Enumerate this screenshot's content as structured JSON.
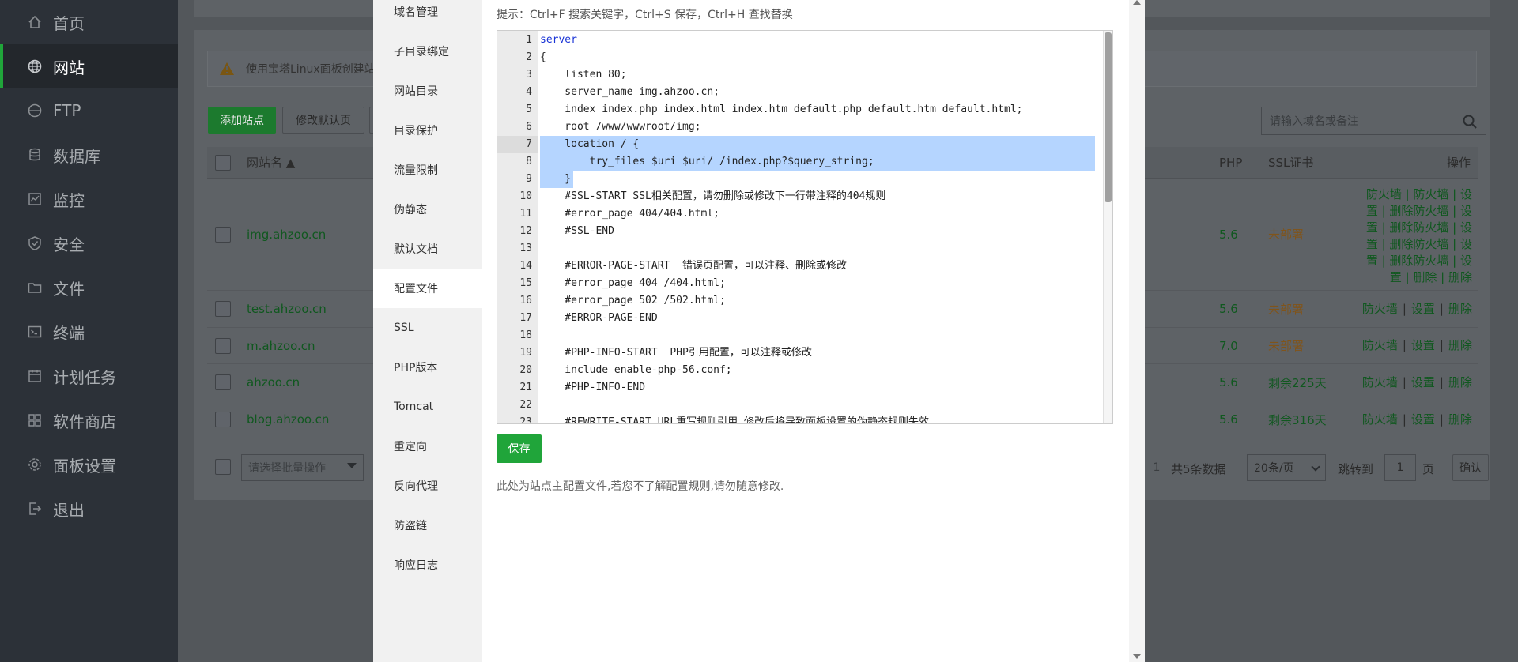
{
  "sidebar": {
    "items": [
      {
        "label": "首页",
        "icon": "home-icon"
      },
      {
        "label": "网站",
        "icon": "globe-icon"
      },
      {
        "label": "FTP",
        "icon": "ftp-icon"
      },
      {
        "label": "数据库",
        "icon": "database-icon"
      },
      {
        "label": "监控",
        "icon": "monitor-icon"
      },
      {
        "label": "安全",
        "icon": "shield-icon"
      },
      {
        "label": "文件",
        "icon": "folder-icon"
      },
      {
        "label": "终端",
        "icon": "terminal-icon"
      },
      {
        "label": "计划任务",
        "icon": "calendar-icon"
      },
      {
        "label": "软件商店",
        "icon": "apps-icon"
      },
      {
        "label": "面板设置",
        "icon": "gear-icon"
      },
      {
        "label": "退出",
        "icon": "logout-icon"
      }
    ],
    "active_index": 1
  },
  "background": {
    "warning_text": "使用宝塔Linux面板创建站",
    "add_site_label": "添加站点",
    "modify_default_label": "修改默认页",
    "search_placeholder": "请输入域名或备注",
    "headers": {
      "name": "网站名 ▲",
      "php": "PHP",
      "ssl": "SSL证书",
      "ops": "操作"
    },
    "rows": [
      {
        "name": "img.ahzoo.cn",
        "php": "5.6",
        "ssl": "未部署",
        "ssl_state": "warn"
      },
      {
        "name": "test.ahzoo.cn",
        "php": "5.6",
        "ssl": "未部署",
        "ssl_state": "warn"
      },
      {
        "name": "m.ahzoo.cn",
        "php": "7.0",
        "ssl": "未部署",
        "ssl_state": "warn"
      },
      {
        "name": "ahzoo.cn",
        "php": "5.6",
        "ssl": "剩余225天",
        "ssl_state": "ok"
      },
      {
        "name": "blog.ahzoo.cn",
        "php": "5.6",
        "ssl": "剩余316天",
        "ssl_state": "ok"
      }
    ],
    "first_row_ops": [
      "防火墙 | 防火墙 | 设",
      "置 | 删除防火墙 | 设",
      "置 | 删除防火墙 | 设",
      "置 | 删除防火墙 | 设",
      "置 | 删除防火墙 | 设",
      "置 | 删除 | 删除"
    ],
    "ops": {
      "firewall": "防火墙",
      "settings": "设置",
      "delete": "删除",
      "sep": "|"
    },
    "batch_placeholder": "请选择批量操作",
    "page_current": "1",
    "total_label": "共5条数据",
    "per_page": "20条/页",
    "goto_label": "跳转到",
    "goto_value": "1",
    "page_unit": "页",
    "confirm_label": "确认"
  },
  "modal": {
    "nav": [
      "域名管理",
      "子目录绑定",
      "网站目录",
      "目录保护",
      "流量限制",
      "伪静态",
      "默认文档",
      "配置文件",
      "SSL",
      "PHP版本",
      "Tomcat",
      "重定向",
      "反向代理",
      "防盗链",
      "响应日志"
    ],
    "active_index": 7,
    "hint": "提示：Ctrl+F 搜索关键字，Ctrl+S 保存，Ctrl+H 查找替换",
    "save_label": "保存",
    "note": "此处为站点主配置文件,若您不了解配置规则,请勿随意修改.",
    "code_lines": [
      "server",
      "{",
      "    listen 80;",
      "    server_name img.ahzoo.cn;",
      "    index index.php index.html index.htm default.php default.htm default.html;",
      "    root /www/wwwroot/img;",
      "    location / {",
      "        try_files $uri $uri/ /index.php?$query_string;",
      "    }",
      "    #SSL-START SSL相关配置，请勿删除或修改下一行带注释的404规则",
      "    #error_page 404/404.html;",
      "    #SSL-END",
      "",
      "    #ERROR-PAGE-START  错误页配置，可以注释、删除或修改",
      "    #error_page 404 /404.html;",
      "    #error_page 502 /502.html;",
      "    #ERROR-PAGE-END",
      "",
      "    #PHP-INFO-START  PHP引用配置，可以注释或修改",
      "    include enable-php-56.conf;",
      "    #PHP-INFO-END",
      "",
      "    #REWRITE-START URL重写规则引用,修改后将导致面板设置的伪静态规则失效"
    ]
  }
}
